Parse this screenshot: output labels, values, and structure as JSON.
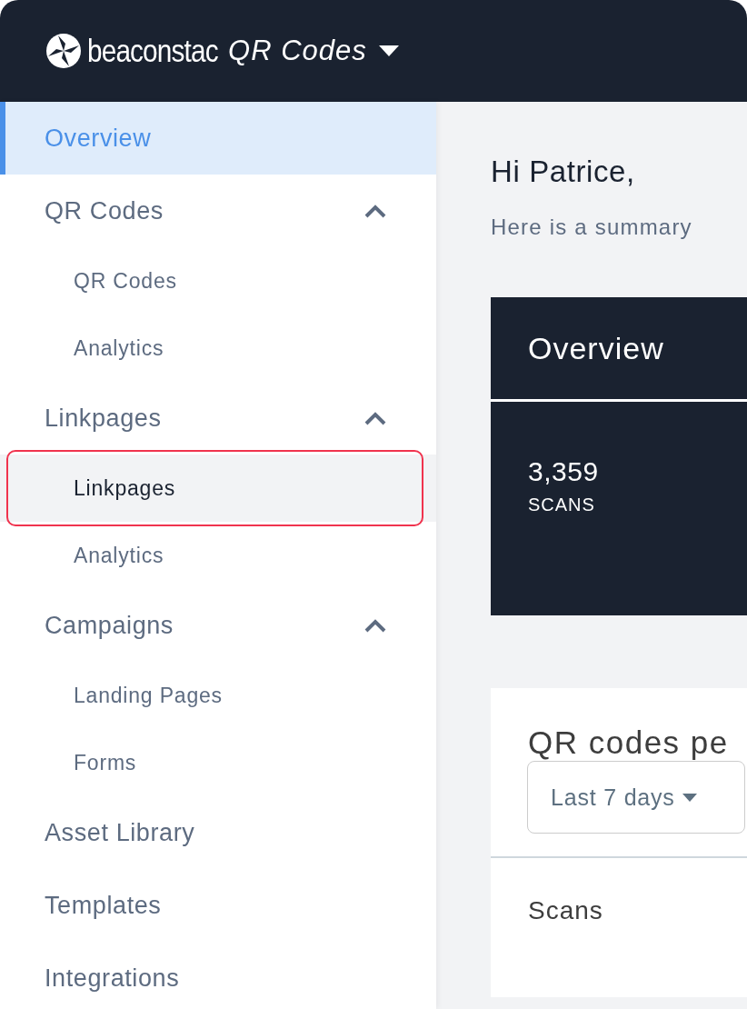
{
  "header": {
    "brand": "beaconstac",
    "product": "QR Codes"
  },
  "sidebar": {
    "items": [
      {
        "kind": "link",
        "label": "Overview",
        "selected": true
      },
      {
        "kind": "group",
        "label": "QR Codes",
        "selected": false,
        "expanded": true,
        "children": [
          {
            "label": "QR Codes",
            "selected": false,
            "outlined": false
          },
          {
            "label": "Analytics",
            "selected": false,
            "outlined": false
          }
        ]
      },
      {
        "kind": "group",
        "label": "Linkpages",
        "selected": false,
        "expanded": true,
        "children": [
          {
            "label": "Linkpages",
            "selected": true,
            "outlined": true
          },
          {
            "label": "Analytics",
            "selected": false,
            "outlined": false
          }
        ]
      },
      {
        "kind": "group",
        "label": "Campaigns",
        "selected": false,
        "expanded": true,
        "children": [
          {
            "label": "Landing Pages",
            "selected": false,
            "outlined": false
          },
          {
            "label": "Forms",
            "selected": false,
            "outlined": false
          }
        ]
      },
      {
        "kind": "link",
        "label": "Asset Library",
        "selected": false
      },
      {
        "kind": "link",
        "label": "Templates",
        "selected": false
      },
      {
        "kind": "link",
        "label": "Integrations",
        "selected": false
      }
    ]
  },
  "main": {
    "greeting": "Hi Patrice,",
    "subtitle": "Here is a summary",
    "overview_card": {
      "title": "Overview",
      "stat_value": "3,359",
      "stat_label": "SCANS"
    },
    "performance_card": {
      "title": "QR codes pe",
      "range": "Last 7 days",
      "metric": "Scans"
    }
  }
}
